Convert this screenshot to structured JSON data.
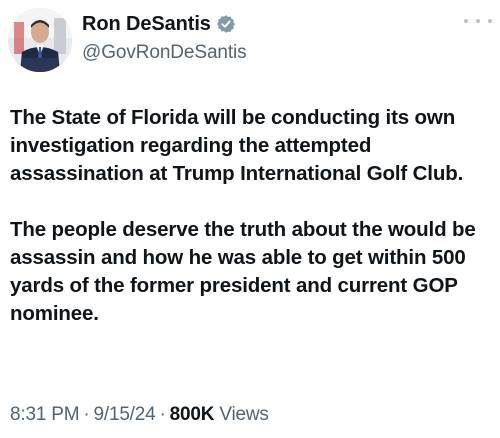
{
  "author": {
    "display_name": "Ron DeSantis",
    "handle": "@GovRonDeSantis",
    "verified": true,
    "badge_color": "#829aab"
  },
  "tweet": {
    "paragraphs": [
      "The State of Florida will be conducting its own investigation regarding the attempted assassination at Trump International Golf Club.",
      "The people deserve the truth about the would be assassin and how he was able to get within 500 yards of the former president and current GOP nominee."
    ]
  },
  "meta": {
    "time": "8:31 PM",
    "date": "9/15/24",
    "separator": "·",
    "views_count": "800K",
    "views_label": "Views"
  },
  "icons": {
    "avatar": "profile-photo",
    "verified": "verified-badge-icon",
    "more": "more-options-icon"
  }
}
